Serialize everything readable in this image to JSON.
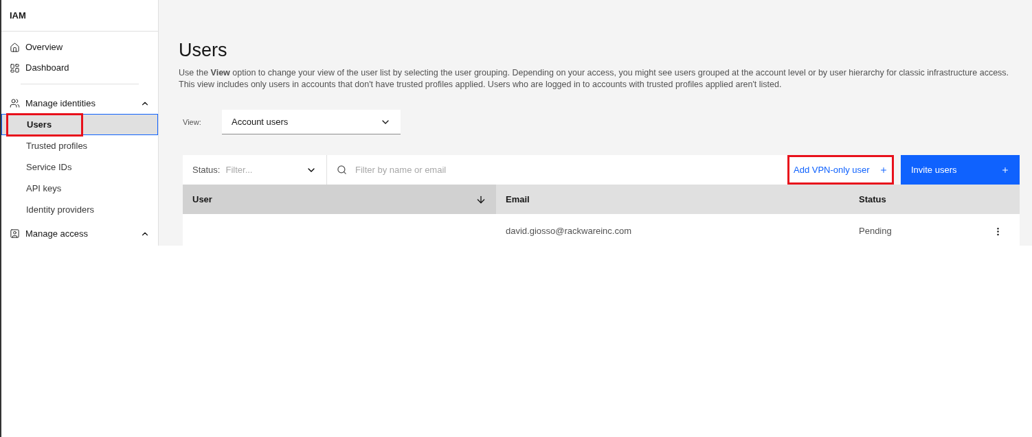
{
  "sidebar": {
    "title": "IAM",
    "items": [
      {
        "kind": "link",
        "label": "Overview",
        "selected": false,
        "annotated": false
      },
      {
        "kind": "link",
        "label": "Dashboard",
        "selected": false,
        "annotated": false
      },
      {
        "kind": "divider"
      },
      {
        "kind": "group",
        "label": "Manage identities",
        "expanded": true,
        "children": [
          {
            "label": "Users",
            "selected": true,
            "annotated": true
          },
          {
            "label": "Trusted profiles",
            "selected": false,
            "annotated": false
          },
          {
            "label": "Service IDs",
            "selected": false,
            "annotated": false
          },
          {
            "label": "API keys",
            "selected": false,
            "annotated": false
          },
          {
            "label": "Identity providers",
            "selected": false,
            "annotated": false
          }
        ]
      },
      {
        "kind": "group",
        "label": "Manage access",
        "expanded": true
      }
    ]
  },
  "page": {
    "title": "Users",
    "description": "Use the **View** option to change your view of the user list by selecting the user grouping. Depending on your access, you might see users grouped at the account level or by user hierarchy for classic infrastructure access. This view includes only users in accounts that don't have trusted profiles applied. Users who are logged in to accounts with trusted profiles applied aren't listed.",
    "view": {
      "label": "View:",
      "value": "Account users"
    }
  },
  "toolbar": {
    "status_label": "Status:",
    "status_placeholder": "Filter...",
    "search_placeholder": "Filter by name or email",
    "buttons": [
      {
        "kind": "ghost",
        "label": "Add VPN-only user",
        "annotated": true
      },
      {
        "kind": "primary",
        "label": "Invite users",
        "annotated": false
      }
    ]
  },
  "table": {
    "columns": [
      {
        "label": "User",
        "sorted": true
      },
      {
        "label": "Email",
        "sorted": false
      },
      {
        "label": "Status",
        "sorted": false
      }
    ],
    "rows": [
      [
        "",
        "david.giosso@rackwareinc.com",
        "Pending"
      ]
    ]
  }
}
